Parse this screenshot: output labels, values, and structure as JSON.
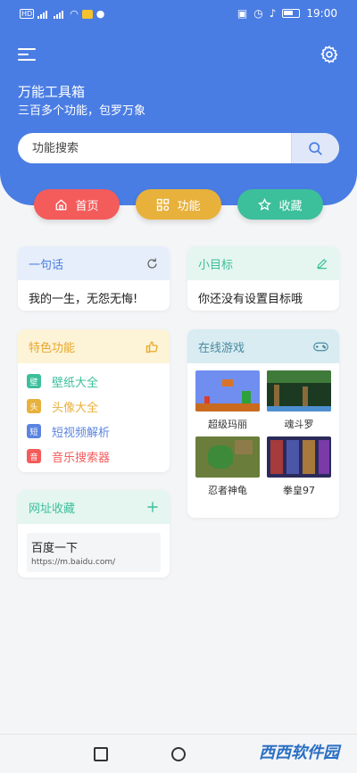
{
  "status_bar": {
    "time": "19:00",
    "left_indicators": [
      "HD",
      "4G",
      "4G",
      "wifi",
      "notify",
      "qq"
    ]
  },
  "header": {
    "title": "万能工具箱",
    "subtitle": "三百多个功能，包罗万象"
  },
  "search": {
    "placeholder": "功能搜索"
  },
  "tabs": [
    {
      "label": "首页",
      "icon": "home-icon",
      "color": "#f45b5b"
    },
    {
      "label": "功能",
      "icon": "grid-icon",
      "color": "#e8b13b"
    },
    {
      "label": "收藏",
      "icon": "star-icon",
      "color": "#3cbf9b"
    }
  ],
  "quote_card": {
    "title": "一句话",
    "text": "我的一生，无怨无悔!",
    "head_color": "#e6eefb",
    "title_color": "#4a7de3"
  },
  "goal_card": {
    "title": "小目标",
    "text": "你还没有设置目标哦",
    "head_color": "#e4f6ef",
    "title_color": "#3cbf9b"
  },
  "feature_card": {
    "title": "特色功能",
    "head_color": "#fdf3d6",
    "title_color": "#e8a82b",
    "items": [
      {
        "badge": "壁",
        "label": "壁纸大全",
        "color": "#3cbf9b"
      },
      {
        "badge": "头",
        "label": "头像大全",
        "color": "#e8b13b"
      },
      {
        "badge": "短",
        "label": "短视频解析",
        "color": "#5b84e0"
      },
      {
        "badge": "音",
        "label": "音乐搜索器",
        "color": "#f45b5b"
      }
    ]
  },
  "games_card": {
    "title": "在线游戏",
    "head_color": "#d8ecf1",
    "title_color": "#4a8aa0",
    "games": [
      {
        "name": "超级玛丽"
      },
      {
        "name": "魂斗罗"
      },
      {
        "name": "忍者神龟"
      },
      {
        "name": "拳皇97"
      }
    ]
  },
  "bookmark_card": {
    "title": "网址收藏",
    "head_color": "#e4f6ef",
    "title_color": "#3cbf9b",
    "items": [
      {
        "title": "百度一下",
        "url": "https://m.baidu.com/"
      }
    ]
  },
  "watermark": "西西软件园"
}
